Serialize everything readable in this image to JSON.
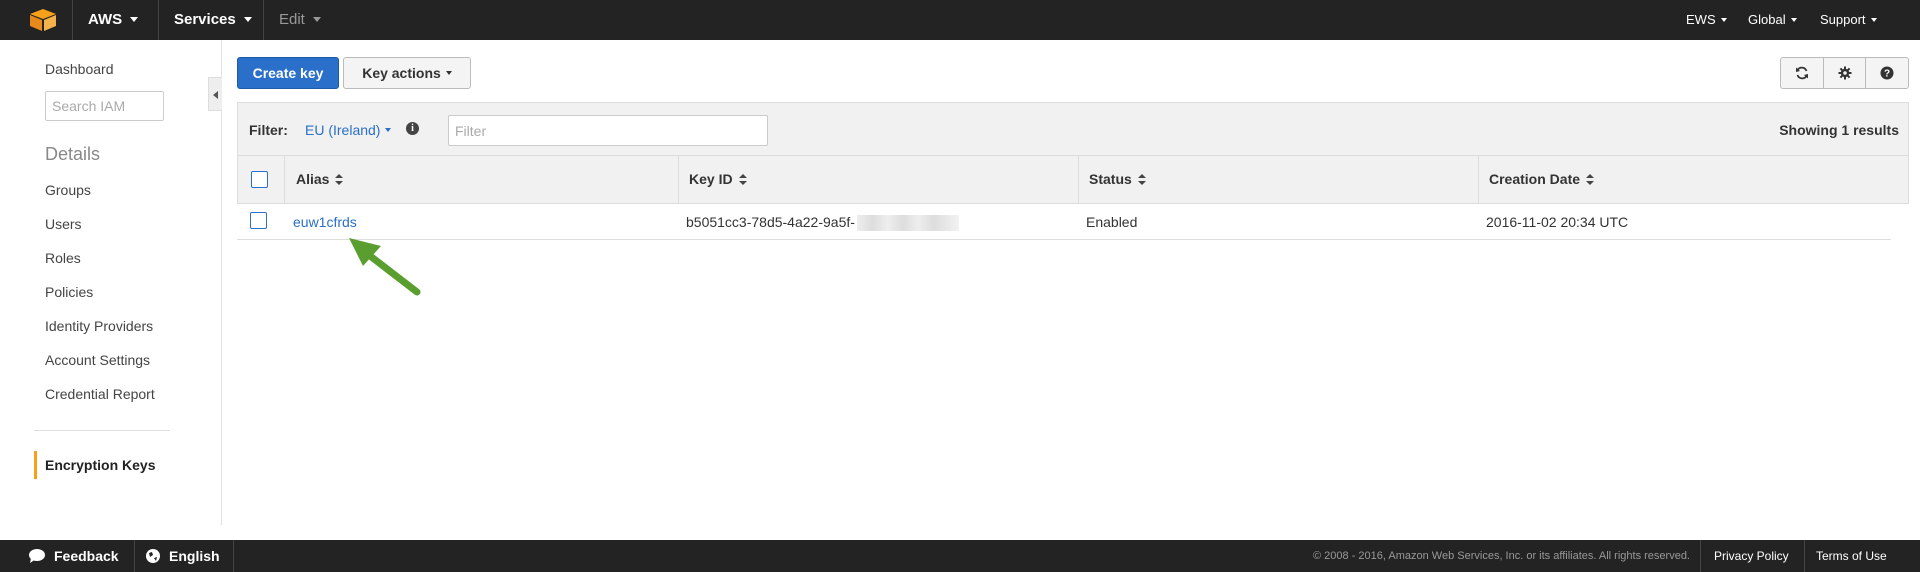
{
  "topnav": {
    "brand": "AWS",
    "services": "Services",
    "edit": "Edit",
    "account": "EWS",
    "region": "Global",
    "support": "Support"
  },
  "sidebar": {
    "dashboard": "Dashboard",
    "search_placeholder": "Search IAM",
    "details_heading": "Details",
    "items": [
      "Groups",
      "Users",
      "Roles",
      "Policies",
      "Identity Providers",
      "Account Settings",
      "Credential Report"
    ],
    "active_item": "Encryption Keys"
  },
  "toolbar": {
    "create_key": "Create key",
    "key_actions": "Key actions"
  },
  "filter": {
    "label": "Filter:",
    "region": "EU (Ireland)",
    "placeholder": "Filter",
    "results": "Showing 1 results"
  },
  "table": {
    "headers": [
      "Alias",
      "Key ID",
      "Status",
      "Creation Date"
    ],
    "rows": [
      {
        "alias": "euw1cfrds",
        "key_id": "b5051cc3-78d5-4a22-9a5f-",
        "status": "Enabled",
        "creation_date": "2016-11-02 20:34 UTC"
      }
    ]
  },
  "footer": {
    "feedback": "Feedback",
    "language": "English",
    "copyright": "© 2008 - 2016, Amazon Web Services, Inc. or its affiliates. All rights reserved.",
    "privacy": "Privacy Policy",
    "terms": "Terms of Use"
  },
  "colors": {
    "accent": "#2a6fc9",
    "nav_bg": "#232323",
    "active_marker": "#f7a11a",
    "arrow": "#5a9e2f"
  }
}
